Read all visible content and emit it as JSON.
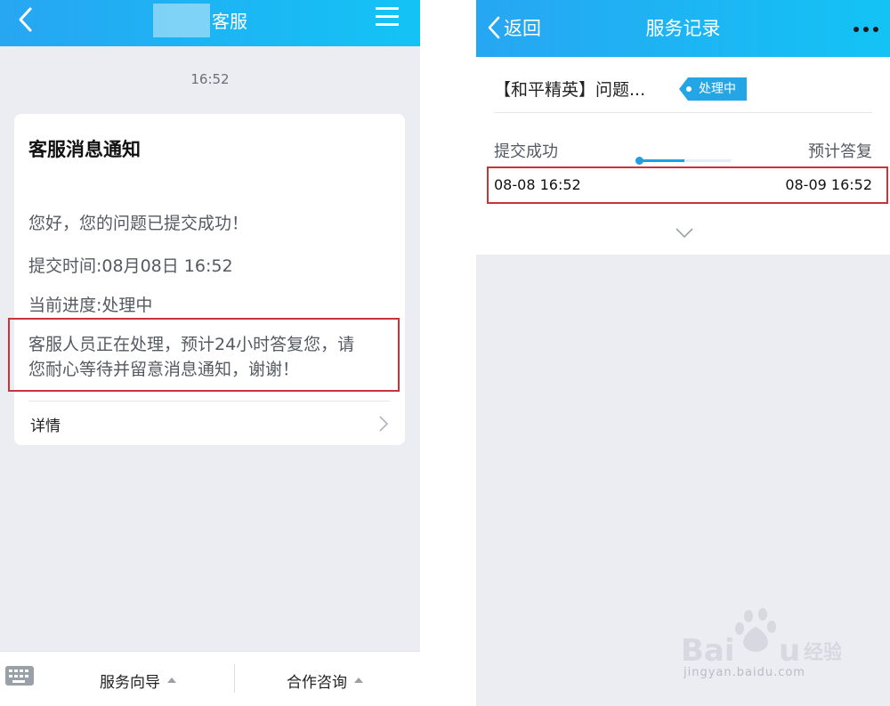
{
  "left_screen": {
    "header": {
      "title": "客服",
      "back_icon": "back-arrow-icon",
      "menu_icon": "hamburger-menu-icon"
    },
    "timestamp": "16:52",
    "card": {
      "title": "客服消息通知",
      "greeting": "您好，您的问题已提交成功！",
      "submit_time": "提交时间:08月08日 16:52",
      "progress": "当前进度:处理中",
      "notice_line1": "客服人员正在处理，预计24小时答复您，请",
      "notice_line2": "您耐心等待并留意消息通知，谢谢！",
      "detail_label": "详情"
    },
    "bottom_bar": {
      "keyboard_icon": "keyboard-icon",
      "item_a": "服务向导",
      "item_b": "合作咨询"
    }
  },
  "right_screen": {
    "header": {
      "back_label": "返回",
      "title": "服务记录",
      "more_icon": "more-dots-icon"
    },
    "record": {
      "case_title": "【和平精英】问题...",
      "status_badge": "处理中",
      "step_start": "提交成功",
      "step_end": "预计答复",
      "date_start": "08-08 16:52",
      "date_end": "08-09 16:52",
      "progress": 0.5
    }
  },
  "watermark": {
    "brand": "Baidu 经验",
    "url": "jingyan.baidu.com"
  },
  "colors": {
    "header_gradient_start": "#27a6f2",
    "header_gradient_end": "#13c3f5",
    "highlight": "#c8343a",
    "accent": "#1e9fe4"
  }
}
